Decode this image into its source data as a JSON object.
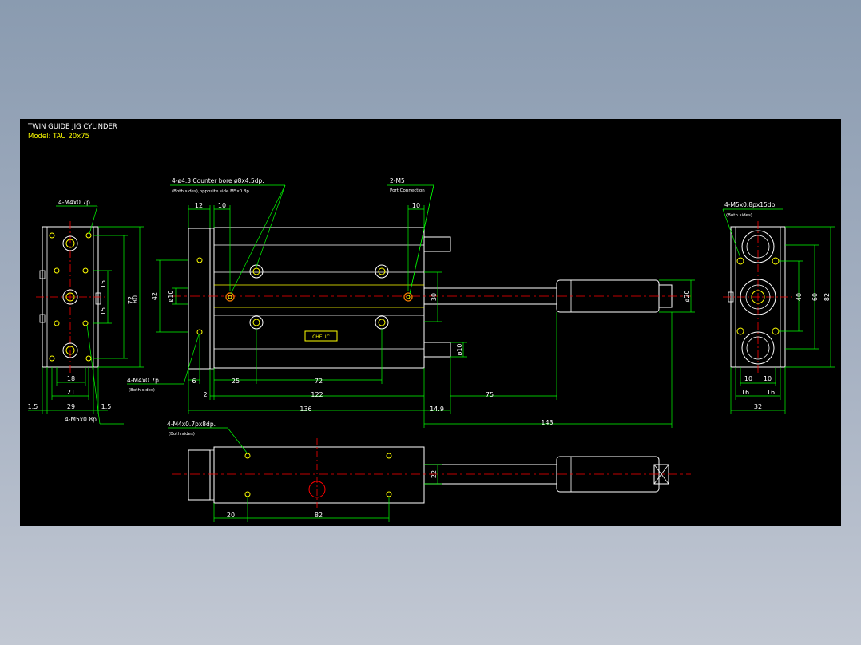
{
  "title": {
    "line1": "TWIN GUIDE JIG CYLINDER",
    "line2": "Model: TAU 20x75"
  },
  "colors": {
    "background": "#000000",
    "outline": "#ffffff",
    "dimension": "#00ff00",
    "centerline": "#ff0000",
    "hole": "#ffff00",
    "port": "#ff8000"
  },
  "callouts": {
    "left_top": "4-M4x0.7p",
    "left_bottom": "4-M5x0.8p",
    "front_counterbore_1": "4-ø4.3  Counter bore ø8x4.5dp.",
    "front_counterbore_2": "(Both sides),opposite side M5x0.8p",
    "port_1": "2-M5",
    "port_2": "Port Connection",
    "front_side_1": "4-M4x0.7p",
    "front_side_2": "(Both sides)",
    "right_top_1": "4-M5x0.8px15dp",
    "right_top_2": "(Both sides)",
    "bottom_1": "4-M4x0.7px8dp.",
    "bottom_2": "(Both sides)"
  },
  "dims": {
    "left_18": "18",
    "left_21": "21",
    "left_29": "29",
    "left_1_5a": "1.5",
    "left_1_5b": "1.5",
    "left_15a": "15",
    "left_15b": "15",
    "left_72": "72",
    "left_80": "80",
    "front_12": "12",
    "front_10a": "10",
    "front_10b": "10",
    "front_42": "42",
    "front_d10": "ø10",
    "front_30": "30",
    "front_d20": "ø20",
    "front_d10b": "ø10",
    "front_6": "6",
    "front_25": "25",
    "front_72": "72",
    "front_2": "2",
    "front_122": "122",
    "front_75": "75",
    "front_136": "136",
    "front_14_9": "14.9",
    "front_143": "143",
    "right_40": "40",
    "right_60": "60",
    "right_82": "82",
    "right_10a": "10",
    "right_10b": "10",
    "right_16a": "16",
    "right_16b": "16",
    "right_32": "32",
    "bottom_22": "22",
    "bottom_20": "20",
    "bottom_82": "82"
  },
  "logo_text": "CHELIC"
}
